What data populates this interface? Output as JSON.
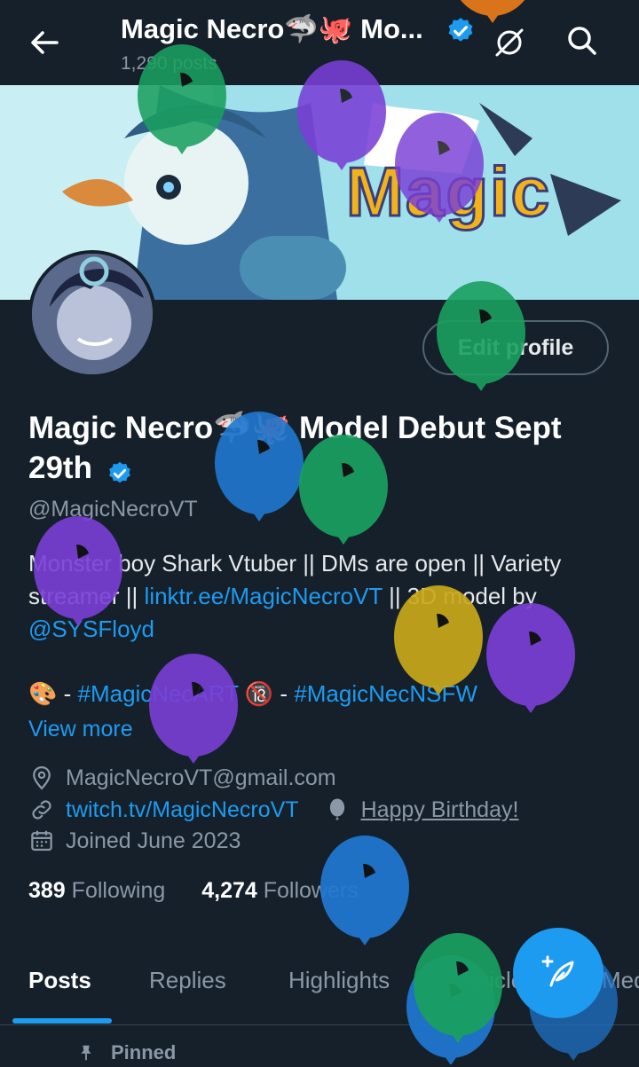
{
  "header": {
    "title": "Magic Necro🦈🐙 Mo...",
    "posts_count": "1,290 posts"
  },
  "profile": {
    "edit_button": "Edit profile",
    "name": "Magic Necro🦈🐙 Model Debut Sept 29th",
    "handle": "@MagicNecroVT",
    "bio": {
      "text1": "Monster boy Shark Vtuber || DMs are open || Variety streamer || ",
      "link": "linktr.ee/MagicNecroVT",
      "text2": " || 3D model by ",
      "mention": "@SYSFloyd",
      "line2_prefix": "🎨 - ",
      "tag1": "#MagicNecART",
      "line2_mid": " 🔞 - ",
      "tag2": "#MagicNecNSFW"
    },
    "view_more": "View more",
    "email": "MagicNecroVT@gmail.com",
    "website": "twitch.tv/MagicNecroVT",
    "birthday": "Happy Birthday!",
    "joined": "Joined June 2023",
    "following_count": "389",
    "following_label": "Following",
    "followers_count": "4,274",
    "followers_label": "Followers"
  },
  "tabs": [
    "Posts",
    "Replies",
    "Highlights",
    "Articles",
    "Media"
  ],
  "active_tab": "Posts",
  "pinned_label": "Pinned",
  "banner_text": "Magic",
  "colors": {
    "background": "#15202b",
    "accent": "#1d9bf0",
    "muted": "#8b98a5"
  }
}
